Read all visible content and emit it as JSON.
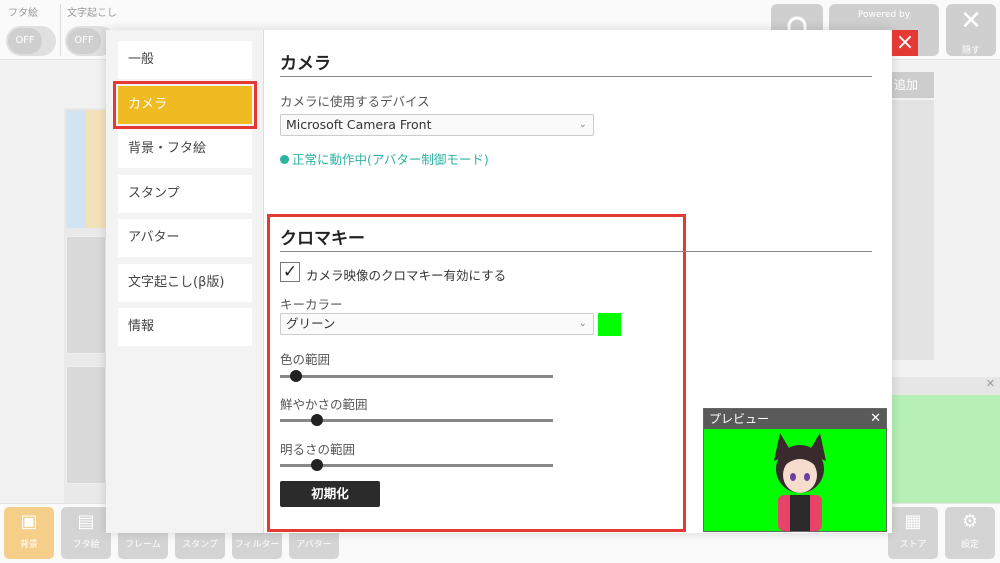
{
  "background_app": {
    "toggles": [
      {
        "label": "フタ絵",
        "state": "OFF"
      },
      {
        "label": "文字起こし",
        "state": "OFF"
      }
    ],
    "powered_by": "Powered by",
    "hide_label": "隠す",
    "right_partial_button": "追加",
    "toolbar": [
      {
        "icon": "background-icon",
        "label": "背景"
      },
      {
        "icon": "futae-icon",
        "label": "フタ絵"
      },
      {
        "icon": "frame-icon",
        "label": "フレーム"
      },
      {
        "icon": "stamp-icon",
        "label": "スタンプ"
      },
      {
        "icon": "filter-icon",
        "label": "フィルター"
      },
      {
        "icon": "avatar-icon",
        "label": "アバター"
      }
    ],
    "store_label": "ストア",
    "settings_label": "設定"
  },
  "settings": {
    "sidebar": [
      {
        "label": "一般",
        "active": false
      },
      {
        "label": "カメラ",
        "active": true
      },
      {
        "label": "背景・フタ絵",
        "active": false
      },
      {
        "label": "スタンプ",
        "active": false
      },
      {
        "label": "アバター",
        "active": false
      },
      {
        "label": "文字起こし(β版)",
        "active": false
      },
      {
        "label": "情報",
        "active": false
      }
    ],
    "camera": {
      "title": "カメラ",
      "device_label": "カメラに使用するデバイス",
      "device_value": "Microsoft Camera Front",
      "status": "正常に動作中(アバター制御モード)",
      "status_color": "#2bb3a2"
    },
    "chroma": {
      "title": "クロマキー",
      "enable_label": "カメラ映像のクロマキー有効にする",
      "enabled": true,
      "key_color_label": "キーカラー",
      "key_color_value": "グリーン",
      "key_color_hex": "#00ff00",
      "sliders": [
        {
          "label": "色の範囲",
          "value": 0.04
        },
        {
          "label": "鮮やかさの範囲",
          "value": 0.12
        },
        {
          "label": "明るさの範囲",
          "value": 0.12
        }
      ],
      "reset_label": "初期化"
    }
  },
  "preview": {
    "title": "プレビュー",
    "background_color": "#00ff00"
  },
  "accent_colors": {
    "active_tab": "#f0bb22",
    "highlight": "#e53935"
  }
}
